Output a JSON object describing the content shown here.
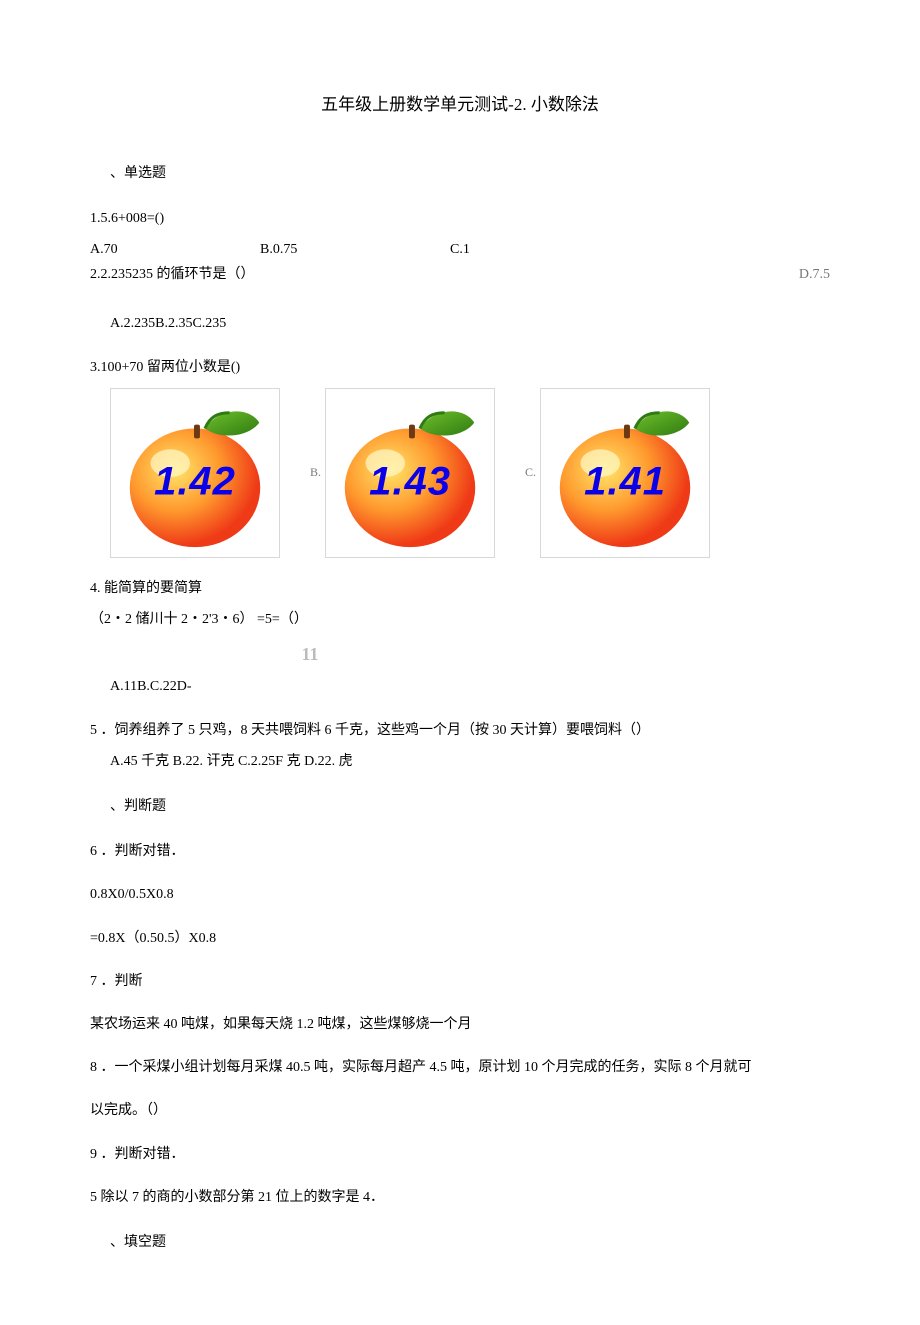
{
  "title": "五年级上册数学单元测试-2. 小数除法",
  "sections": {
    "mc": "、单选题",
    "tf": "、判断题",
    "fill": "、填空题"
  },
  "q1": {
    "stem": "1.5.6+008=()",
    "optA": "A.70",
    "optB": "B.0.75",
    "optC": "C.1",
    "optD": "D.7.5"
  },
  "q2": {
    "stem": "2.2.235235 的循环节是（）",
    "opts": "A.2.235B.2.35C.235"
  },
  "q3": {
    "stem": "3.100+70 留两位小数是()",
    "peachA": "1.42",
    "labelB": "B.",
    "peachB": "1.43",
    "labelC": "C.",
    "peachC": "1.41"
  },
  "q4": {
    "line1": "4. 能简算的要简算",
    "line2": "（2・2 储川十 2・2'3・6） =5=（）",
    "gray": "11",
    "opts": "A.11B.C.22D-"
  },
  "q5": {
    "stem": "5 ．饲养组养了 5 只鸡，8 天共喂饲料 6 千克，这些鸡一个月（按 30 天计算）要喂饲料（）",
    "opts": "A.45 千克 B.22. 讦克 C.2.25F 克 D.22. 虎"
  },
  "q6": {
    "line1": "6 ．判断对错．",
    "line2": "0.8X0/0.5X0.8",
    "line3": "=0.8X（0.50.5）X0.8"
  },
  "q7": {
    "line1": "7 ．判断",
    "line2": "某农场运来 40 吨煤，如果每天烧 1.2 吨煤，这些煤够烧一个月"
  },
  "q8": {
    "line1": "8 ．一个采煤小组计划每月采煤 40.5 吨，实际每月超产 4.5 吨，原计划 10 个月完成的任务，实际 8 个月就可",
    "line2": "以完成。（）"
  },
  "q9": {
    "line1": "9 ．判断对错．",
    "line2": "5 除以 7 的商的小数部分第 21 位上的数字是 4．"
  }
}
